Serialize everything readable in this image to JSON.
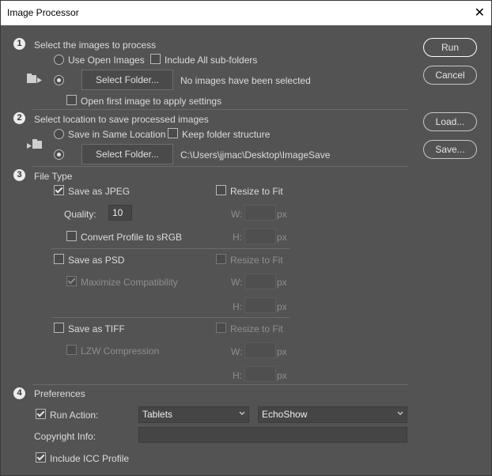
{
  "window": {
    "title": "Image Processor",
    "close": "✕"
  },
  "steps": {
    "s1": "1",
    "s2": "2",
    "s3": "3",
    "s4": "4"
  },
  "section1": {
    "heading": "Select the images to process",
    "use_open_images": "Use Open Images",
    "include_subfolders": "Include All sub-folders",
    "select_folder": "Select Folder...",
    "status": "No images have been selected",
    "open_first_image": "Open first image to apply settings"
  },
  "section2": {
    "heading": "Select location to save processed images",
    "same_location": "Save in Same Location",
    "keep_structure": "Keep folder structure",
    "select_folder": "Select Folder...",
    "path": "C:\\Users\\jjmac\\Desktop\\ImageSave"
  },
  "section3": {
    "heading": "File Type",
    "jpeg": {
      "label": "Save as JPEG",
      "quality_label": "Quality:",
      "quality_value": "10",
      "convert_profile": "Convert Profile to sRGB",
      "resize": "Resize to Fit",
      "w": "W:",
      "h": "H:",
      "unit": "px"
    },
    "psd": {
      "label": "Save as PSD",
      "maximize": "Maximize Compatibility",
      "resize": "Resize to Fit",
      "w": "W:",
      "h": "H:",
      "unit": "px"
    },
    "tiff": {
      "label": "Save as TIFF",
      "lzw": "LZW Compression",
      "resize": "Resize to Fit",
      "w": "W:",
      "h": "H:",
      "unit": "px"
    }
  },
  "section4": {
    "heading": "Preferences",
    "run_action": "Run Action:",
    "action_set": "Tablets",
    "action": "EchoShow",
    "copyright_label": "Copyright Info:",
    "copyright_value": "",
    "include_icc": "Include ICC Profile"
  },
  "buttons": {
    "run": "Run",
    "cancel": "Cancel",
    "load": "Load...",
    "save": "Save..."
  }
}
